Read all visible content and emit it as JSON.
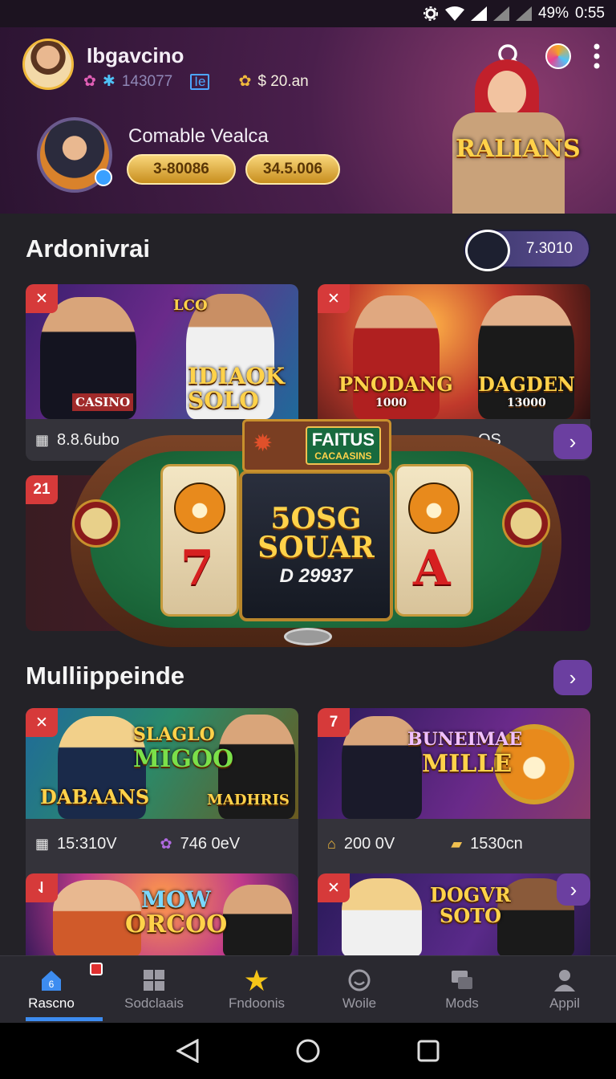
{
  "status_bar": {
    "battery": "49%",
    "time": "0:55"
  },
  "header": {
    "username": "Ibgavcino",
    "stat_1": "143077",
    "stat_2": "Ie",
    "stat_3": "$ 20.an",
    "promo_title": "Comable Vealca",
    "pill_1": "3-80086",
    "pill_2": "34.5.006",
    "mascot_banner": "RALIANS"
  },
  "section_1": {
    "title": "Ardonivrai",
    "balance": "7.3010",
    "cards": [
      {
        "badge": "✕",
        "title": "IDIAOK SOLO",
        "tag": "CASINO",
        "corner": "LCO",
        "footer": "8.8.6ub​o"
      },
      {
        "badge": "✕",
        "title": "PNODANG",
        "subtitle": "1000",
        "title2": "DAGDEN",
        "subtitle2": "13000",
        "footer": "OS"
      }
    ],
    "row2_badge": "21",
    "slot": {
      "sign_1": "FAITUS",
      "sign_2": "CACAASINS",
      "big": "5OSG SOUAR",
      "amount": "D 29937"
    }
  },
  "section_2": {
    "title": "Mulliippeinde",
    "cards": [
      {
        "badge": "✕",
        "title": "SLAGLO",
        "title2": "MIGOO",
        "title3": "DABAANS",
        "title4": "MADHRIS",
        "footer_1": "15:310V",
        "footer_2": "746 0eV"
      },
      {
        "badge": "7",
        "title": "BUNEIMAE",
        "title2": "MILLE",
        "footer_1": "200 0V",
        "footer_2": "1530cn"
      },
      {
        "badge": "⇃",
        "title": "MOW",
        "title2": "ORCOO"
      },
      {
        "badge": "✕",
        "title": "DOGVR",
        "title2": "SOTO"
      }
    ]
  },
  "bottom_nav": [
    {
      "label": "Rascno",
      "icon": "home-icon",
      "badge": "6",
      "active": true
    },
    {
      "label": "Sodclaais",
      "icon": "grid-icon",
      "active": false
    },
    {
      "label": "Fndoonis",
      "icon": "star-icon",
      "active": false
    },
    {
      "label": "Woile",
      "icon": "face-icon",
      "active": false
    },
    {
      "label": "Mods",
      "icon": "chat-icon",
      "active": false
    },
    {
      "label": "Appil",
      "icon": "user-icon",
      "active": false
    }
  ],
  "colors": {
    "accent": "#6b3fa0",
    "gold": "#f0b93c",
    "active_nav": "#3d8cf0",
    "badge_red": "#d63a3a"
  }
}
